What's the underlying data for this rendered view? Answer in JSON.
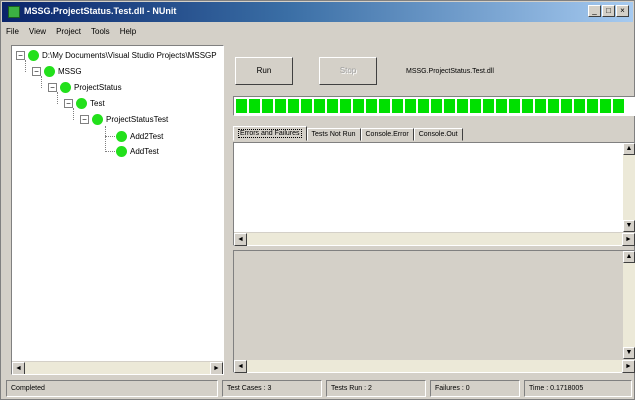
{
  "window": {
    "title": "MSSG.ProjectStatus.Test.dll - NUnit",
    "buttons": {
      "minimize": "_",
      "maximize": "□",
      "close": "×"
    }
  },
  "menu": {
    "items": [
      "File",
      "View",
      "Project",
      "Tools",
      "Help"
    ]
  },
  "tree": {
    "nodes": [
      {
        "label": "D:\\My Documents\\Visual Studio Projects\\MSSGP",
        "expander": "−"
      },
      {
        "label": "MSSG",
        "expander": "−"
      },
      {
        "label": "ProjectStatus",
        "expander": "−"
      },
      {
        "label": "Test",
        "expander": "−"
      },
      {
        "label": "ProjectStatusTest",
        "expander": "−"
      },
      {
        "label": "Add2Test",
        "expander": ""
      },
      {
        "label": "AddTest",
        "expander": ""
      }
    ],
    "status_color": "#22e01b"
  },
  "toolbar": {
    "run_label": "Run",
    "stop_label": "Stop",
    "assembly": "MSSG.ProjectStatus.Test.dll"
  },
  "progress": {
    "fraction": 1.0,
    "color": "#00e000"
  },
  "tabs": [
    "Errors and Failures",
    "Tests Not Run",
    "Console.Error",
    "Console.Out"
  ],
  "scroll_glyphs": {
    "left": "◄",
    "right": "►",
    "up": "▲",
    "down": "▼"
  },
  "status": {
    "state": "Completed",
    "test_cases": "Test Cases : 3",
    "tests_run": "Tests Run : 2",
    "failures": "Failures : 0",
    "time": "Time : 0.1718005"
  }
}
